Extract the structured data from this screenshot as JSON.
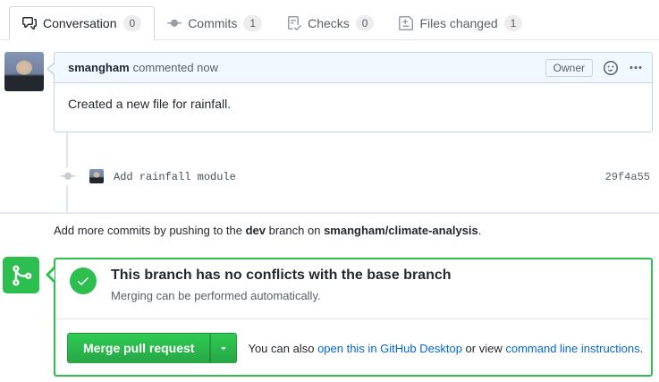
{
  "tabs": [
    {
      "label": "Conversation",
      "count": "0"
    },
    {
      "label": "Commits",
      "count": "1"
    },
    {
      "label": "Checks",
      "count": "0"
    },
    {
      "label": "Files changed",
      "count": "1"
    }
  ],
  "comment": {
    "author": "smangham",
    "meta": "commented now",
    "badge": "Owner",
    "body": "Created a new file for rainfall."
  },
  "commit": {
    "message": "Add rainfall module",
    "hash": "29f4a55"
  },
  "push_note": {
    "text_1": "Add more commits by pushing to the ",
    "branch": "dev",
    "text_2": " branch on ",
    "repo": "smangham/climate-analysis",
    "text_3": "."
  },
  "merge": {
    "title": "This branch has no conflicts with the base branch",
    "subtitle": "Merging can be performed automatically.",
    "button_label": "Merge pull request",
    "alt_1": "You can also ",
    "link_desktop": "open this in GitHub Desktop",
    "alt_2": " or view ",
    "link_cli": "command line instructions",
    "alt_3": "."
  },
  "colors": {
    "accent_green": "#2cbe4e",
    "link_blue": "#0366d6",
    "comment_header_blue": "#f1f8ff"
  }
}
